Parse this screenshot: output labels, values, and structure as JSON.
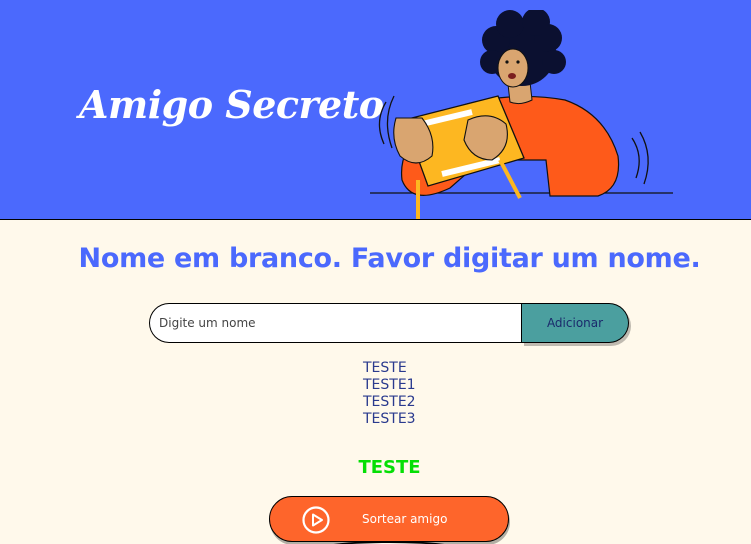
{
  "header": {
    "title": "Amigo Secreto",
    "illustration": "person-holding-game-controller-illustration"
  },
  "main": {
    "message": "Nome em branco. Favor digitar um nome.",
    "input": {
      "placeholder": "Digite um nome",
      "value": ""
    },
    "add_button_label": "Adicionar",
    "friends": [
      "TESTE",
      "TESTE1",
      "TESTE2",
      "TESTE3"
    ],
    "result": "TESTE",
    "draw_button": {
      "label": "Sortear amigo",
      "icon": "play-circle-icon"
    }
  },
  "colors": {
    "header_bg": "#4B69FD",
    "page_bg": "#FFF9EB",
    "title_text": "#4B69FD",
    "add_button_bg": "#4B9F9F",
    "draw_button_bg": "#FE652B",
    "result_text": "#05DF05",
    "list_text": "#2A3A8E"
  }
}
